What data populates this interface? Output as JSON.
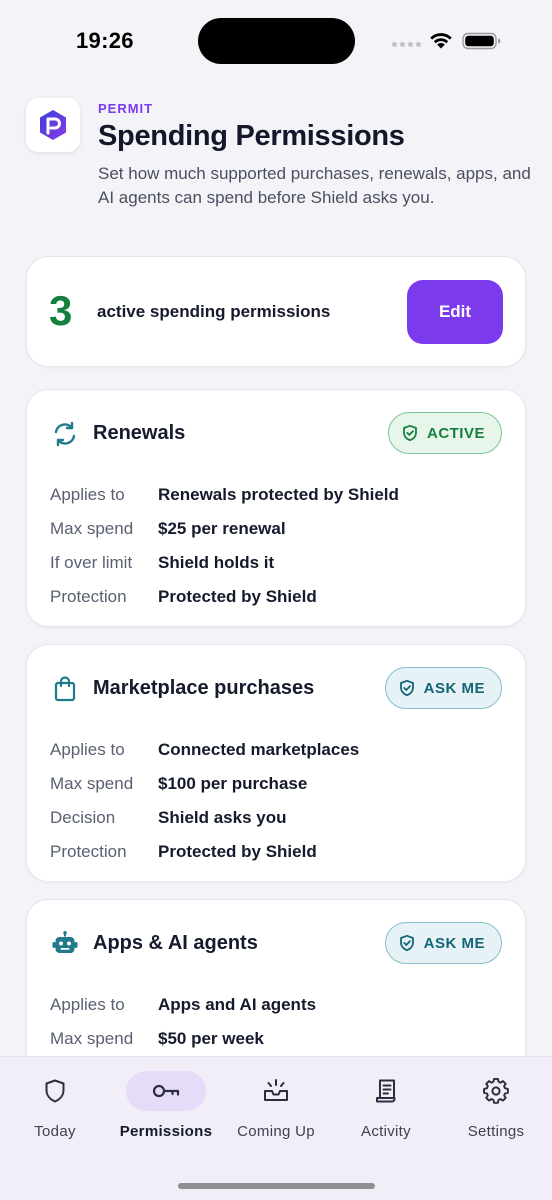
{
  "status_bar": {
    "time": "19:26"
  },
  "header": {
    "eyebrow": "PERMIT",
    "title": "Spending Permissions",
    "subtitle": "Set how much supported purchases, renewals, apps, and AI agents can spend before Shield asks you."
  },
  "summary": {
    "count": "3",
    "label": "active spending permissions",
    "edit_label": "Edit"
  },
  "cards": [
    {
      "icon": "refresh-icon",
      "title": "Renewals",
      "badge": "ACTIVE",
      "rows": [
        {
          "key": "Applies to",
          "value": "Renewals protected by Shield"
        },
        {
          "key": "Max spend",
          "value": "$25 per renewal"
        },
        {
          "key": "If over limit",
          "value": "Shield holds it"
        },
        {
          "key": "Protection",
          "value": "Protected by Shield"
        }
      ]
    },
    {
      "icon": "shopping-bag-icon",
      "title": "Marketplace purchases",
      "badge": "ASK ME",
      "rows": [
        {
          "key": "Applies to",
          "value": "Connected marketplaces"
        },
        {
          "key": "Max spend",
          "value": "$100 per purchase"
        },
        {
          "key": "Decision",
          "value": "Shield asks you"
        },
        {
          "key": "Protection",
          "value": "Protected by Shield"
        }
      ]
    },
    {
      "icon": "robot-icon",
      "title": "Apps & AI agents",
      "badge": "ASK ME",
      "rows": [
        {
          "key": "Applies to",
          "value": "Apps and AI agents"
        },
        {
          "key": "Max spend",
          "value": "$50 per week"
        }
      ]
    }
  ],
  "tab_bar": {
    "tabs": [
      {
        "label": "Today",
        "icon": "shield-icon"
      },
      {
        "label": "Permissions",
        "icon": "key-icon",
        "selected": true
      },
      {
        "label": "Coming Up",
        "icon": "inbox-icon"
      },
      {
        "label": "Activity",
        "icon": "receipt-icon"
      },
      {
        "label": "Settings",
        "icon": "gear-icon"
      }
    ]
  },
  "colors": {
    "accent": "#7c3aed",
    "active_green": "#15803d",
    "ask_teal": "#136577",
    "background": "#f4f3f8"
  }
}
